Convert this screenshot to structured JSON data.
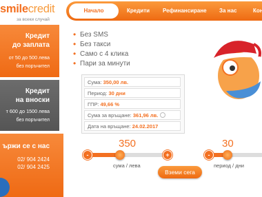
{
  "logo": {
    "name_smile": "smile",
    "name_credit": "credit",
    "tagline": "за всеки случай"
  },
  "nav": [
    {
      "label": "Начало",
      "active": true
    },
    {
      "label": "Кредити"
    },
    {
      "label": "Рефинансиране"
    },
    {
      "label": "За нас"
    },
    {
      "label": "Конт"
    }
  ],
  "sidebar": {
    "credit_salary": {
      "title_line1": "Кредит",
      "title_line2": "до заплата",
      "text_line1": "от 50 до 500 лева",
      "text_line2": "без поръчител"
    },
    "credit_installments": {
      "title_line1": "Кредит",
      "title_line2": "на вноски",
      "text_line1": "т 600 до 1500 лева",
      "text_line2": "без поръчител"
    },
    "contact": {
      "title": "ържи се с нас",
      "phone1": "02/ 904 2424",
      "phone2": "02/ 904 2425"
    }
  },
  "benefits": [
    "Без SMS",
    "Без такси",
    "Само с 4 клика",
    "Пари за минути"
  ],
  "summary": {
    "amount_label": "Сума:",
    "amount_value": "350,00 лв.",
    "period_label": "Период:",
    "period_value": "30 дни",
    "apr_label": "ГПР:",
    "apr_value": "49,66 %",
    "repay_label": "Сума за връщане:",
    "repay_value": "361,96 лв.",
    "date_label": "Дата на връщане:",
    "date_value": "24.02.2017"
  },
  "sliders": {
    "amount": {
      "value": "350",
      "label": "сума / лева",
      "minus": "-",
      "plus": "+",
      "fill": 0.42
    },
    "period": {
      "value": "30",
      "label": "период / дни",
      "minus": "-",
      "fill": 0.35
    }
  },
  "cta_label": "Вземи сега",
  "colors": {
    "accent": "#f37021",
    "sidebar_gray": "#5f5f5f"
  }
}
